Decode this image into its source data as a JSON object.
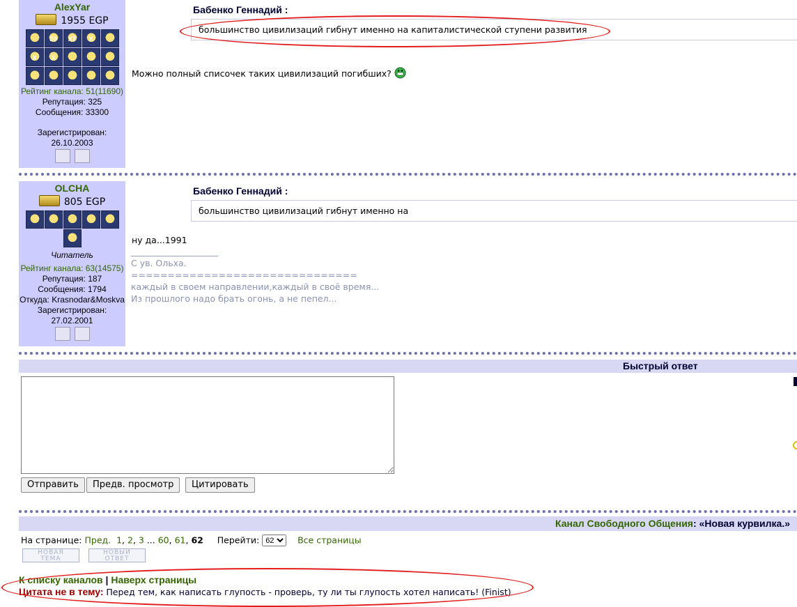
{
  "post1": {
    "user": {
      "name": "AlexYar",
      "egp": "1955 EGP",
      "rating": "Рейтинг канала: 51(11690)",
      "reputation": "Репутация: 325",
      "posts": "Сообщения: 33300",
      "registered_label": "Зарегистрирован:",
      "registered_date": "26.10.2003",
      "badges": [
        "",
        "20",
        "XT",
        "X",
        "",
        "X",
        "X",
        "",
        "",
        "",
        "",
        "",
        "",
        "",
        ""
      ]
    },
    "quote_author": "Бабенко Геннадий :",
    "quote_text": "большинство цивилизаций гибнут именно на капиталистической ступени развития",
    "body": "Можно полный списочек таких цивилизаций погибших?"
  },
  "post2": {
    "user": {
      "name": "OLCHA",
      "egp": "805 EGP",
      "title": "Читатель",
      "rating": "Рейтинг канала: 63(14575)",
      "reputation": "Репутация: 187",
      "posts": "Сообщения: 1794",
      "location": "Откуда: Krasnodar&Moskva",
      "registered_label": "Зарегистрирован:",
      "registered_date": "27.02.2001"
    },
    "quote_author": "Бабенко Геннадий :",
    "quote_text": "большинство цивилизаций гибнут именно на",
    "body": "ну да...1991",
    "sig_rule": "____________________",
    "signature": [
      "С ув. Ольха.",
      "===============================",
      "каждый в своем направлении,каждый в своё время...",
      "Из прошлого надо брать огонь, а не пепел..."
    ]
  },
  "quick_reply": {
    "title": "Быстрый ответ",
    "textarea_value": "",
    "buttons": {
      "send": "Отправить",
      "preview": "Предв. просмотр",
      "quote": "Цитировать"
    }
  },
  "footer": {
    "channel_label": "Канал Свободного Общения",
    "thread_title": "«Новая курвилка.»",
    "pages_label": "На странице:",
    "prev": "Пред.",
    "pages": [
      "1",
      "2",
      "3"
    ],
    "ellipsis": "...",
    "pages_tail": [
      "60",
      "61"
    ],
    "current_page": "62",
    "goto_label": "Перейти:",
    "goto_value": "62",
    "all_pages": "Все страницы",
    "new_topic": "НОВАЯ ТЕМА",
    "new_reply": "НОВЫЙ ОТВЕТ",
    "to_channels": "К списку каналов",
    "sep": "|",
    "to_top": "Наверх страницы",
    "offtopic_label": "Цитата не в тему:",
    "offtopic_text": "Перед тем, как написать глупость - проверь, ту ли ты глупость хотел написать! (Finist)"
  },
  "colors": {
    "sidebar_bg": "#ccccff",
    "link_green": "#336600",
    "annotation_red": "#e31b1b",
    "dark_red": "#990000"
  }
}
